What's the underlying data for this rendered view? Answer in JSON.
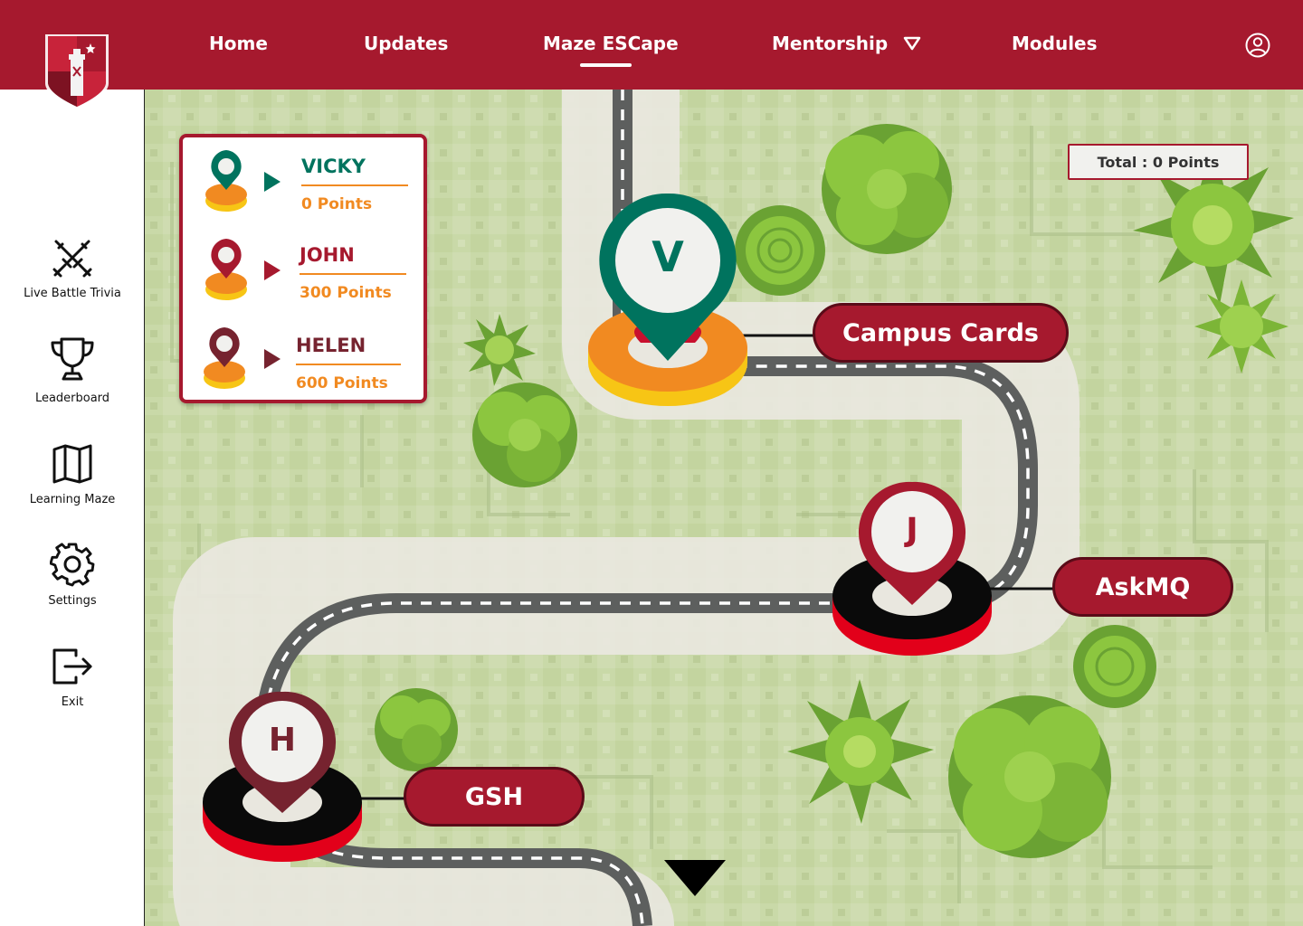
{
  "nav": {
    "home": "Home",
    "updates": "Updates",
    "maze": "Maze ESCape",
    "mentorship": "Mentorship",
    "modules": "Modules"
  },
  "sidebar": {
    "items": [
      {
        "label": "Live Battle Trivia",
        "icon": "swords-icon"
      },
      {
        "label": "Leaderboard",
        "icon": "trophy-icon"
      },
      {
        "label": "Learning Maze",
        "icon": "map-icon"
      },
      {
        "label": "Settings",
        "icon": "gear-icon"
      },
      {
        "label": "Exit",
        "icon": "exit-icon"
      }
    ]
  },
  "players": [
    {
      "name": "VICKY",
      "points": "0 Points",
      "color": "#00735e"
    },
    {
      "name": "JOHN",
      "points": "300 Points",
      "color": "#a6192e"
    },
    {
      "name": "HELEN",
      "points": "600 Points",
      "color": "#76232f"
    }
  ],
  "total": "Total : 0 Points",
  "markers": [
    {
      "letter": "V",
      "color": "#00735e"
    },
    {
      "letter": "J",
      "color": "#a6192e"
    },
    {
      "letter": "H",
      "color": "#76232f"
    }
  ],
  "destinations": [
    "Campus Cards",
    "AskMQ",
    "GSH"
  ],
  "colors": {
    "brand": "#a6192e",
    "accent": "#f18a21",
    "road": "#5d5f5e"
  }
}
